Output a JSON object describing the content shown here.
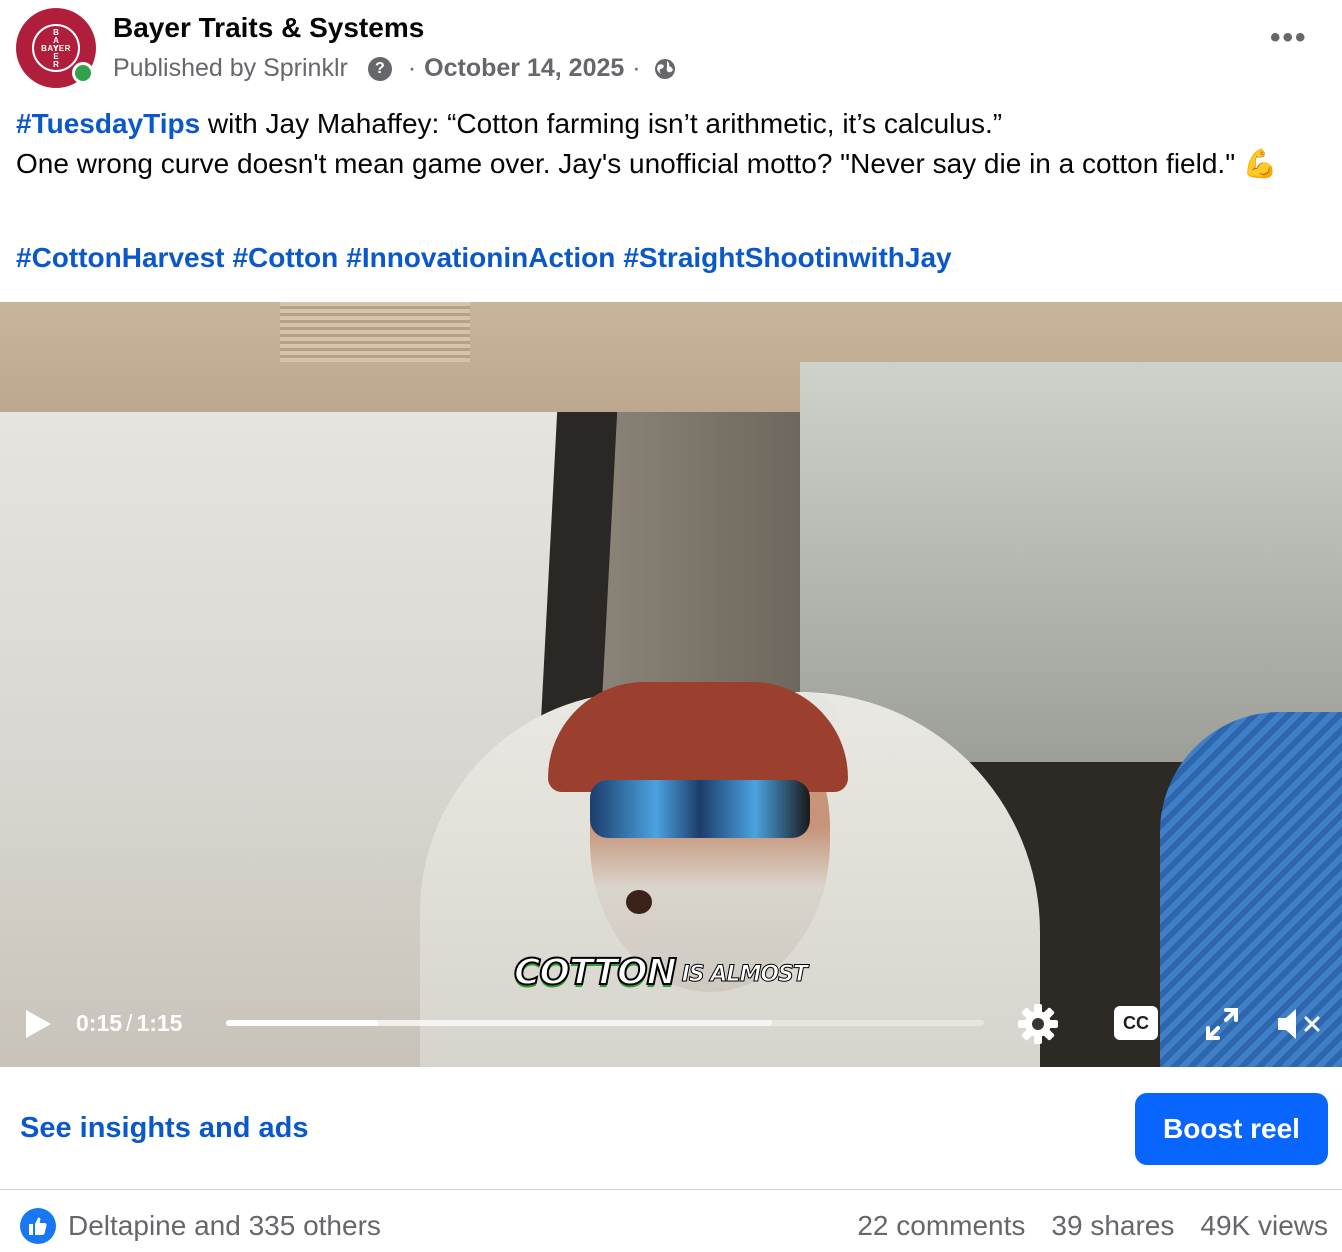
{
  "header": {
    "page_name": "Bayer Traits & Systems",
    "published_by": "Published by Sprinklr",
    "help_glyph": "?",
    "date": "October 14, 2025",
    "separator": "·",
    "more_glyph": "•••",
    "avatar_logo": {
      "horizontal": "BAYER",
      "vertical": "BAYER",
      "color": "#b01e3c"
    },
    "online_color": "#31a24c"
  },
  "post": {
    "hashtag_lead": "#TuesdayTips",
    "line1_rest": " with Jay Mahaffey: “Cotton farming isn’t arithmetic, it’s calculus.”",
    "line2": "One wrong curve doesn't mean game over. Jay's unofficial motto? \"Never say die in a cotton field.\" ",
    "emoji": "💪",
    "hashtags": [
      "#CottonHarvest",
      "#Cotton",
      "#InnovationinAction",
      "#StraightShootinwithJay"
    ],
    "hashtag_color": "#0a58ca"
  },
  "video": {
    "caption_big": "COTTON",
    "caption_small": "IS ALMOST",
    "current_time": "0:15",
    "time_separator": "/",
    "duration": "1:15",
    "played_fraction": 0.2,
    "buffered_fraction": 0.72,
    "cc_label": "CC",
    "icons": [
      "play-icon",
      "gear-icon",
      "cc-icon",
      "expand-icon",
      "mute-icon"
    ]
  },
  "actions": {
    "insights_label": "See insights and ads",
    "boost_label": "Boost reel",
    "boost_color": "#0866ff"
  },
  "stats": {
    "likers": "Deltapine and 335 others",
    "comments": "22 comments",
    "shares": "39 shares",
    "views": "49K views"
  }
}
